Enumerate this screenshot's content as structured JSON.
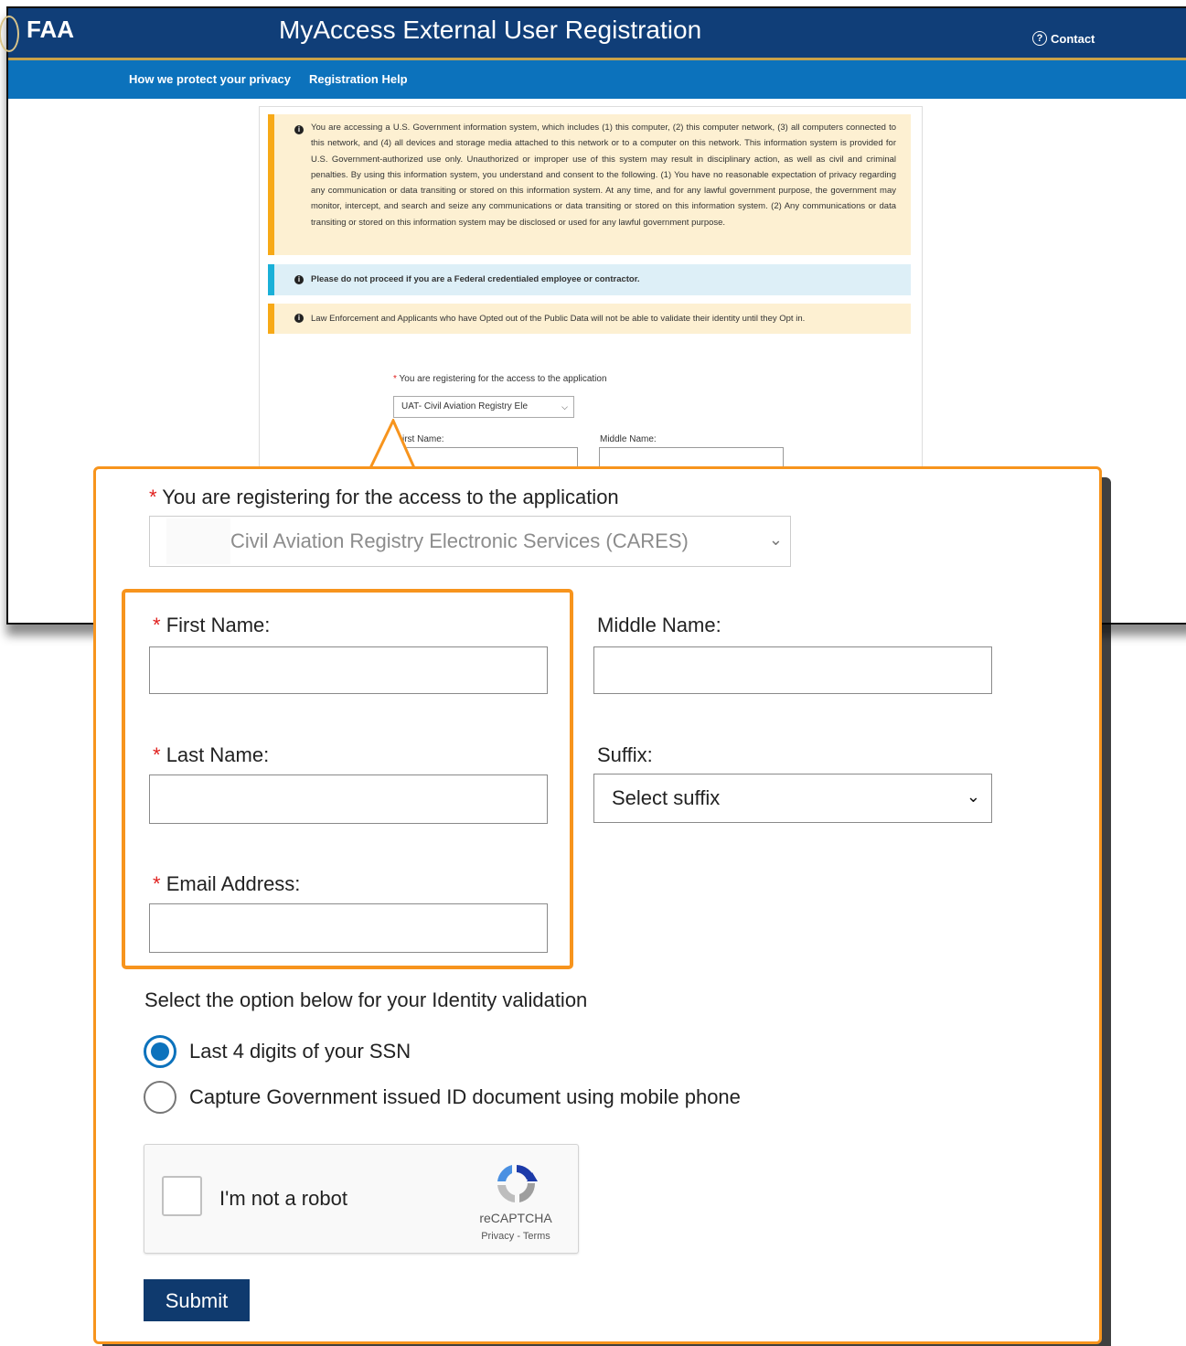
{
  "header": {
    "logo": "FAA",
    "title": "MyAccess External User Registration",
    "contact_label": "Contact"
  },
  "nav": {
    "privacy_link": "How we protect your privacy",
    "help_link": "Registration Help"
  },
  "alerts": {
    "gov_warning": "You are accessing a U.S. Government information system, which includes (1) this computer, (2) this computer network, (3) all computers connected to this network, and (4) all devices and storage media attached to this network or to a computer on this network. This information system is provided for U.S. Government-authorized use only. Unauthorized or improper use of this system may result in disciplinary action, as well as civil and criminal penalties. By using this information system, you understand and consent to the following. (1) You have no reasonable expectation of privacy regarding any communication or data transiting or stored on this information system. At any time, and for any lawful government purpose, the government may monitor, intercept, and search and seize any communications or data transiting or stored on this information system. (2) Any communications or data transiting or stored on this information system may be disclosed or used for any lawful government purpose.",
    "federal_notice": "Please do not proceed if you are a Federal credentialed employee or contractor.",
    "law_enforcement_notice": "Law Enforcement and Applicants who have Opted out of the Public Data will not be able to validate their identity until they Opt in."
  },
  "background_form": {
    "application_label": "You are registering for the access to the application",
    "application_value": "UAT- Civil Aviation Registry Ele",
    "first_name_label": "irst Name:",
    "middle_name_label": "Middle Name:"
  },
  "form": {
    "required_mark": "*",
    "application_label": "You are registering for the access to the application",
    "application_value": "Civil Aviation Registry Electronic Services (CARES)",
    "first_name_label": "First Name:",
    "middle_name_label": "Middle Name:",
    "last_name_label": "Last Name:",
    "suffix_label": "Suffix:",
    "suffix_value": "Select suffix",
    "email_label": "Email Address:",
    "identity_prompt": "Select the option below for your Identity validation",
    "options": [
      {
        "label": "Last 4 digits of your SSN",
        "selected": true
      },
      {
        "label": "Capture Government issued ID document using mobile phone",
        "selected": false
      }
    ],
    "submit_label": "Submit"
  },
  "captcha": {
    "label": "I'm not a robot",
    "brand": "reCAPTCHA",
    "links": "Privacy - Terms"
  },
  "colors": {
    "header": "#103e78",
    "nav": "#0c72bc",
    "highlight": "#f7941d",
    "submit": "#0f3a6e",
    "required": "#e0201e"
  }
}
